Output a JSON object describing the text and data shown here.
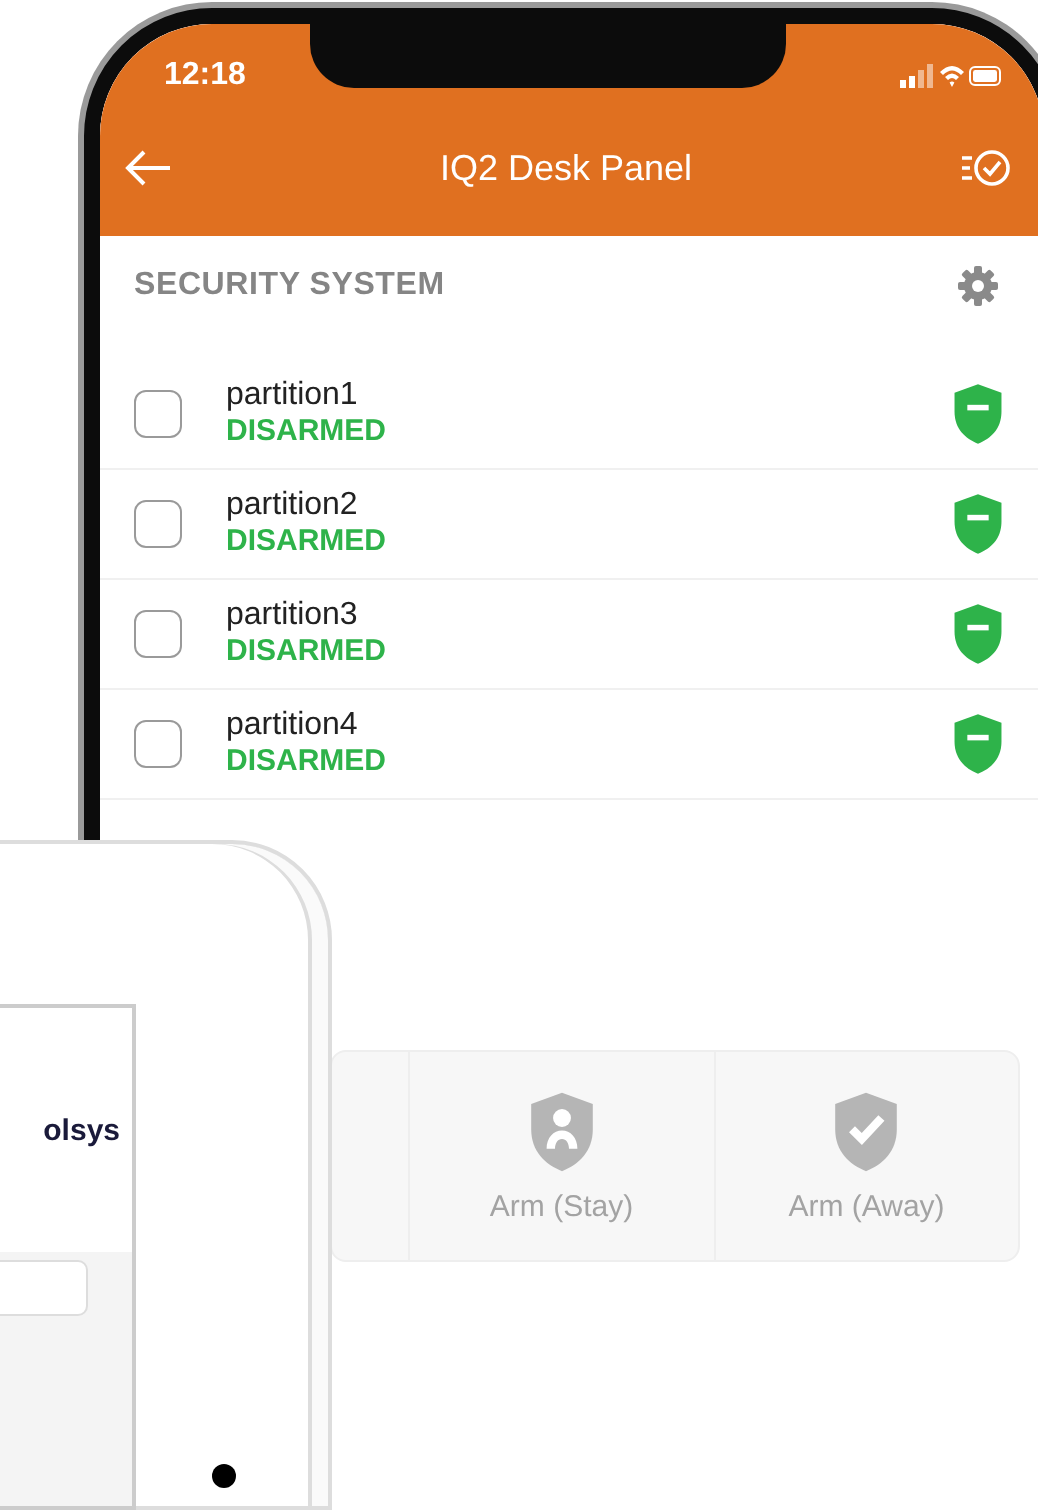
{
  "status_bar": {
    "time": "12:18"
  },
  "app_bar": {
    "title": "IQ2 Desk Panel"
  },
  "section": {
    "title": "SECURITY SYSTEM"
  },
  "partitions": [
    {
      "name": "partition1",
      "status": "DISARMED",
      "kind": "disarmed",
      "checked": false
    },
    {
      "name": "partition2",
      "status": "DISARMED",
      "kind": "disarmed",
      "checked": false
    },
    {
      "name": "partition3",
      "status": "DISARMED",
      "kind": "disarmed",
      "checked": false
    },
    {
      "name": "partition4",
      "status": "DISARMED",
      "kind": "disarmed",
      "checked": false
    }
  ],
  "arm_buttons": [
    {
      "label": "Arm (Stay)",
      "kind": "stay",
      "disabled": true
    },
    {
      "label": "Arm (Away)",
      "kind": "away",
      "disabled": true
    }
  ],
  "device_overlay": {
    "logo": "olsys"
  }
}
